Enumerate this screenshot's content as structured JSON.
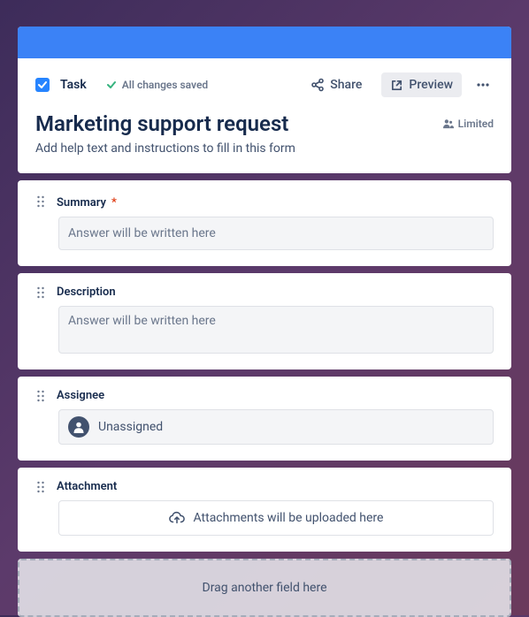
{
  "toolbar": {
    "task_label": "Task",
    "saved_label": "All changes saved",
    "share_label": "Share",
    "preview_label": "Preview"
  },
  "form": {
    "title": "Marketing support request",
    "limited_label": "Limited",
    "help_text": "Add help text and instructions to fill in this form"
  },
  "fields": {
    "summary": {
      "label": "Summary",
      "required_mark": "*",
      "placeholder": "Answer will be written here"
    },
    "description": {
      "label": "Description",
      "placeholder": "Answer will be written here"
    },
    "assignee": {
      "label": "Assignee",
      "value": "Unassigned"
    },
    "attachment": {
      "label": "Attachment",
      "placeholder": "Attachments will be uploaded here"
    }
  },
  "dropzone": {
    "label": "Drag another field here"
  }
}
